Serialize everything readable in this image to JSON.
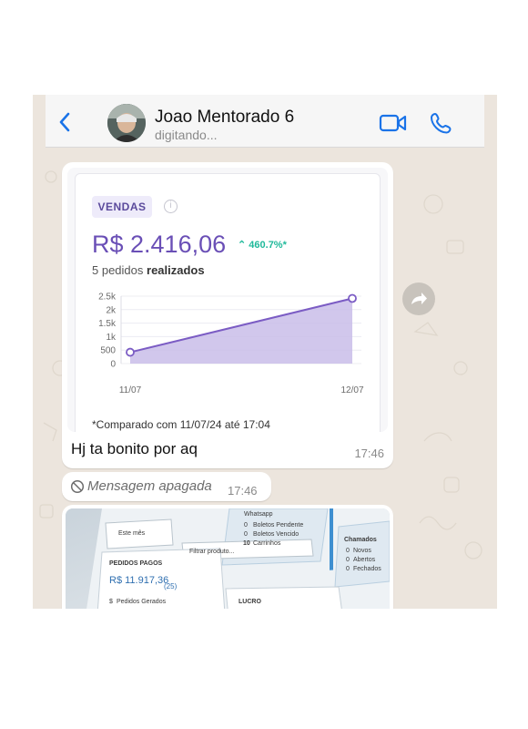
{
  "header": {
    "contact_name": "Joao Mentorado 6",
    "status": "digitando..."
  },
  "messages": {
    "card": {
      "badge": "VENDAS",
      "info": "i",
      "amount": "R$ 2.416,06",
      "growth": "460.7%*",
      "orders_count": "5 pedidos",
      "orders_suffix": "realizados",
      "footnote": "*Comparado com 11/07/24 até 17:04",
      "text": "Hj ta bonito por aq",
      "time": "17:46"
    },
    "deleted": {
      "text": "Mensagem apagada",
      "time": "17:46"
    },
    "photo": {
      "labels": {
        "app": "Whatsapp",
        "boletos_pendente": "Boletos Pendente",
        "boletos_vencido": "Boletos Vencido",
        "carrinhos": "Carrinhos",
        "chamados": "Chamados",
        "novos": "Novos",
        "abertos": "Abertos",
        "fechados": "Fechados",
        "filter_month": "Este mês",
        "filter_product": "Filtrar produto...",
        "pedidos_pagos": "PEDIDOS PAGOS",
        "pedidos_value": "R$ 11.917,36",
        "pedidos_count": "(25)",
        "pedidos_gerados": "Pedidos Gerados",
        "lucro": "LUCRO",
        "count_0a": "0",
        "count_0b": "0",
        "count_10": "10",
        "count_0c": "0",
        "count_0d": "0",
        "count_0e": "0",
        "pedidos_gerados_count": "$"
      }
    }
  },
  "chart_data": {
    "type": "area",
    "x": [
      "11/07",
      "12/07"
    ],
    "values": [
      420,
      2416.06
    ],
    "ylim": [
      0,
      2500
    ],
    "yticks": [
      "0",
      "500",
      "1k",
      "1.5k",
      "2k",
      "2.5k"
    ],
    "color": "#7b5cc4",
    "fill": "#c9bde9"
  },
  "colors": {
    "accent": "#1a73e8",
    "chat_bg": "#ece5dd",
    "purple": "#6a4fb6",
    "green": "#1fb99a"
  }
}
